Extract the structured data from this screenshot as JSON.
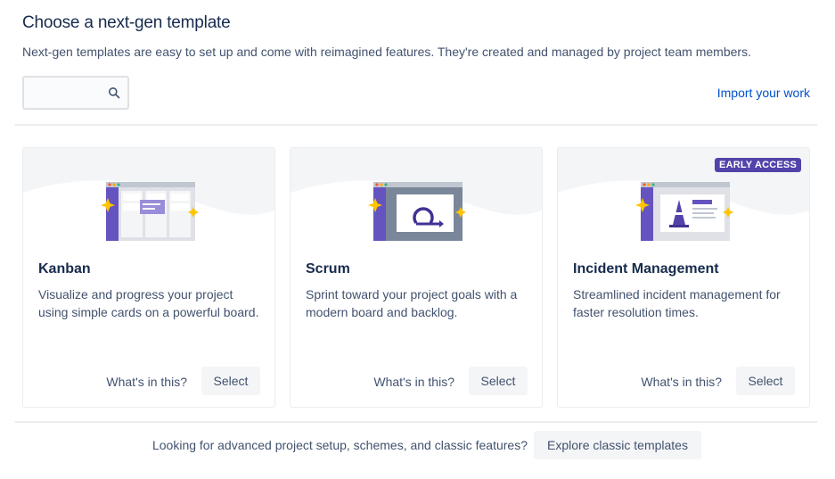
{
  "header": {
    "title": "Choose a next-gen template",
    "subtitle": "Next-gen templates are easy to set up and come with reimagined features. They're created and managed by project team members."
  },
  "search": {
    "value": "",
    "placeholder": "",
    "icon": "search-icon"
  },
  "import_link": "Import your work",
  "templates": [
    {
      "title": "Kanban",
      "description": "Visualize and progress your project using simple cards on a powerful board.",
      "whats_in": "What's in this?",
      "select_label": "Select",
      "illustration": "kanban-board-icon"
    },
    {
      "title": "Scrum",
      "description": "Sprint toward your project goals with a modern board and backlog.",
      "whats_in": "What's in this?",
      "select_label": "Select",
      "illustration": "scrum-cycle-icon"
    },
    {
      "title": "Incident Management",
      "description": "Streamlined incident management for faster resolution times.",
      "whats_in": "What's in this?",
      "select_label": "Select",
      "badge": "EARLY ACCESS",
      "illustration": "incident-cone-icon"
    }
  ],
  "footer": {
    "text": "Looking for advanced project setup, schemes, and classic features?",
    "button_label": "Explore classic templates"
  },
  "colors": {
    "link": "#0052cc",
    "badge": "#5243aa",
    "title": "#172b4d",
    "body_text": "#42526e",
    "button_bg": "#f4f5f7",
    "sparkle": "#ffc400"
  }
}
